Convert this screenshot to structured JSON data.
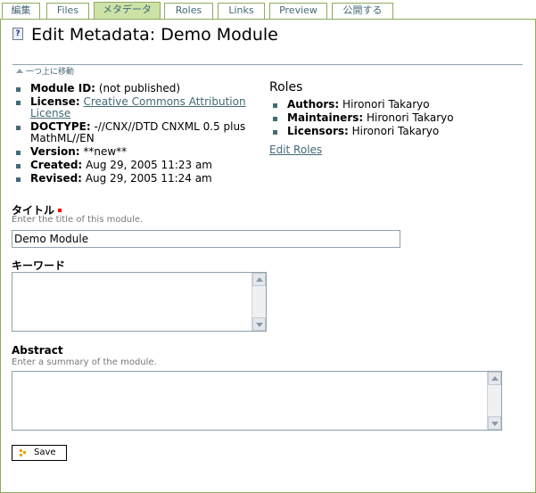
{
  "tabs": [
    {
      "label": "編集",
      "selected": false
    },
    {
      "label": "Files",
      "selected": false
    },
    {
      "label": "メタデータ",
      "selected": true
    },
    {
      "label": "Roles",
      "selected": false
    },
    {
      "label": "Links",
      "selected": false
    },
    {
      "label": "Preview",
      "selected": false
    },
    {
      "label": "公開する",
      "selected": false
    }
  ],
  "header": {
    "title": "Edit Metadata: Demo Module",
    "up_link": "一つ上に移動"
  },
  "metadata": {
    "module_id_label": "Module ID:",
    "module_id_value": "(not published)",
    "license_label": "License:",
    "license_value": "Creative Commons Attribution License",
    "doctype_label": "DOCTYPE:",
    "doctype_value": "-//CNX//DTD CNXML 0.5 plus MathML//EN",
    "version_label": "Version:",
    "version_value": "**new**",
    "created_label": "Created:",
    "created_value": "Aug 29, 2005 11:23 am",
    "revised_label": "Revised:",
    "revised_value": "Aug 29, 2005 11:24 am"
  },
  "roles": {
    "heading": "Roles",
    "authors_label": "Authors:",
    "authors_value": "Hironori Takaryo",
    "maintainers_label": "Maintainers:",
    "maintainers_value": "Hironori Takaryo",
    "licensors_label": "Licensors:",
    "licensors_value": "Hironori Takaryo",
    "edit_link": "Edit Roles"
  },
  "form": {
    "title_label": "タイトル",
    "title_help": "Enter the title of this module.",
    "title_value": "Demo Module",
    "keywords_label": "キーワード",
    "abstract_label": "Abstract",
    "abstract_help": "Enter a summary of the module.",
    "save_label": "Save"
  },
  "colors": {
    "tab_border": "#8cac5c",
    "tab_selected_bg": "#cde2a7",
    "link": "#436976",
    "required_marker": "#ff0000"
  }
}
